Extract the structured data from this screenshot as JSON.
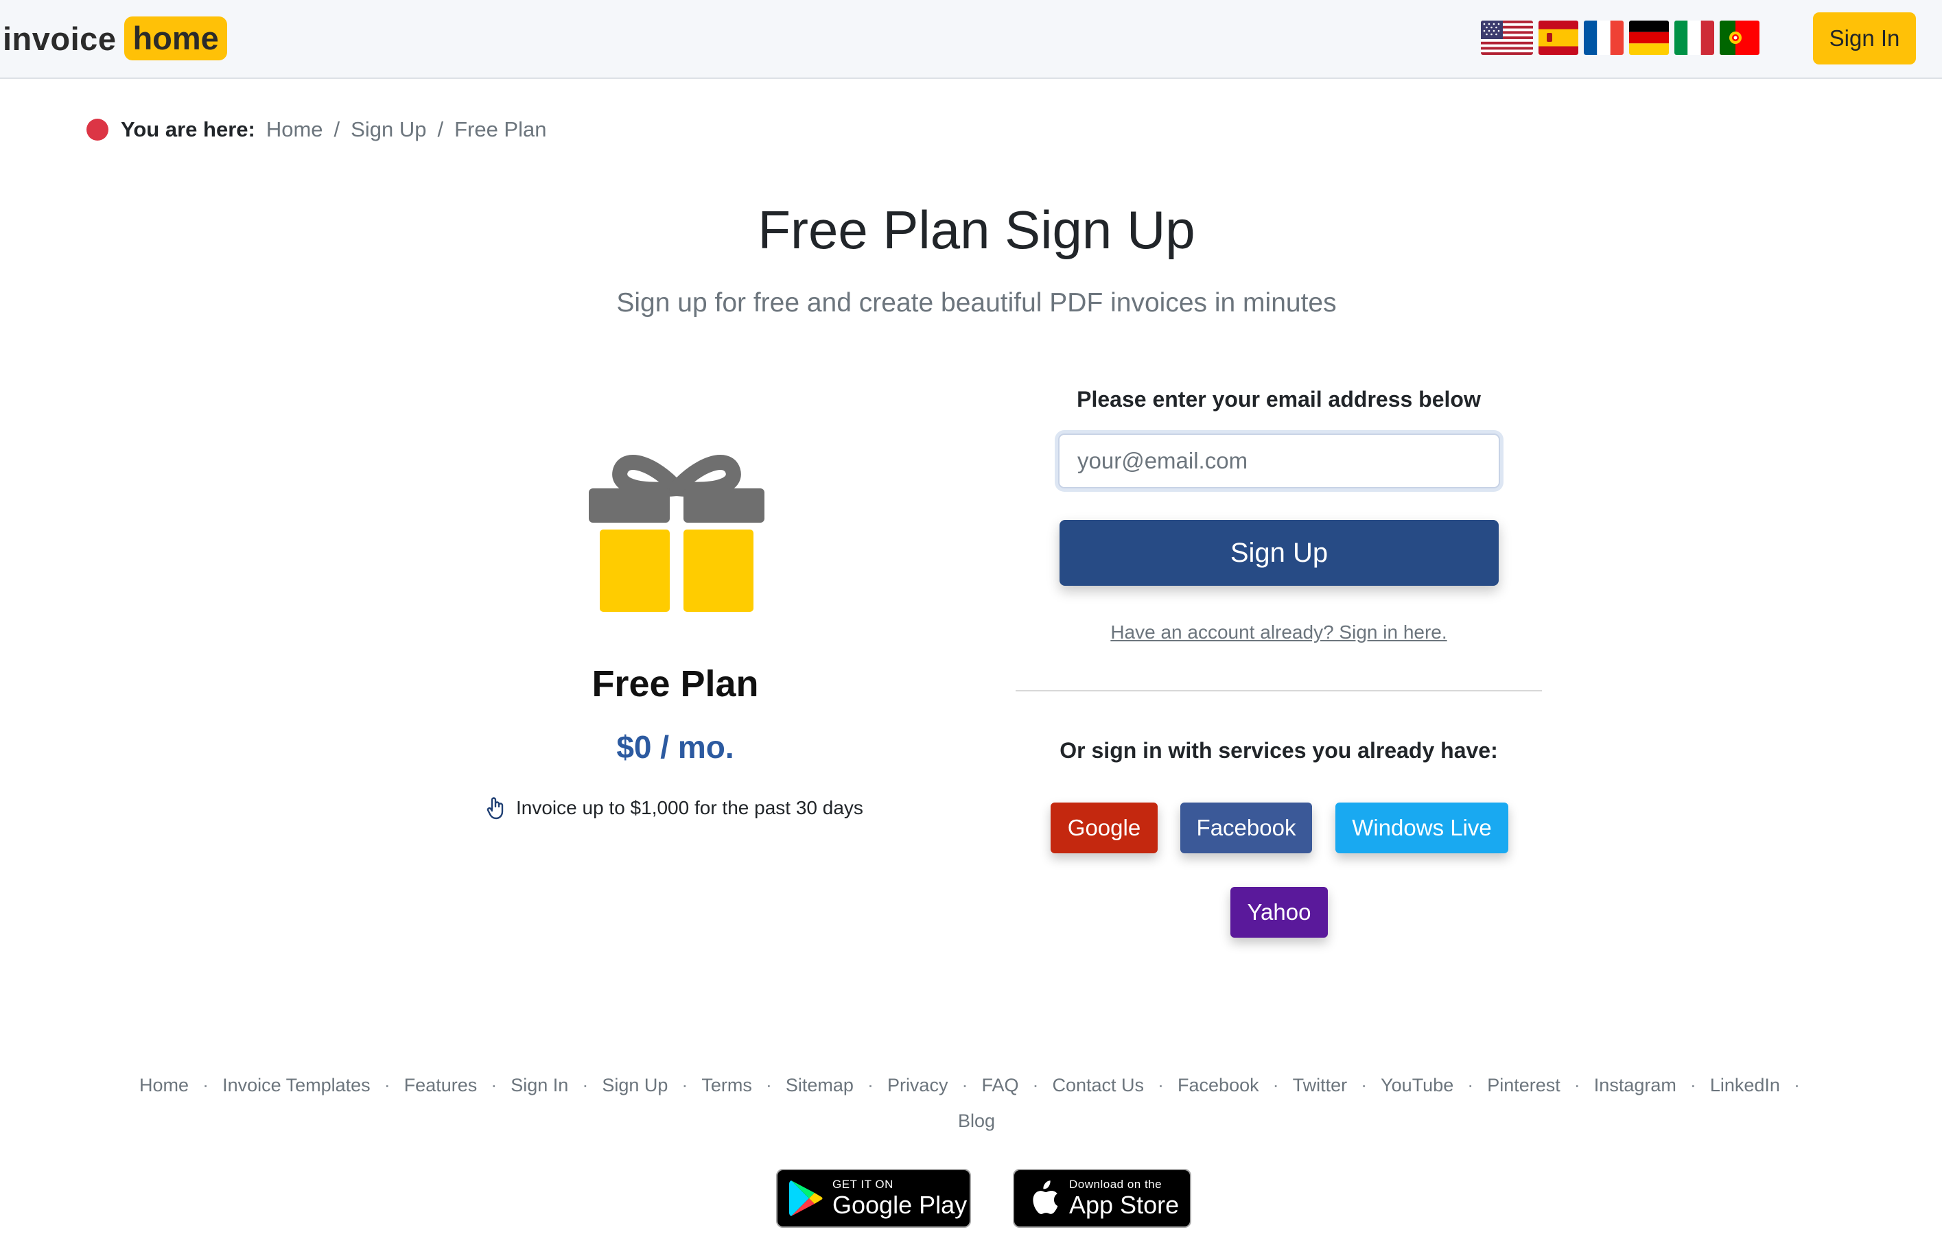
{
  "header": {
    "logo_part1": "invoice",
    "logo_part2": "home",
    "signin_label": "Sign In",
    "flags": [
      "us-flag",
      "spain-flag",
      "france-flag",
      "germany-flag",
      "italy-flag",
      "portugal-flag"
    ]
  },
  "breadcrumb": {
    "here_label": "You are here:",
    "items": [
      "Home",
      "Sign Up"
    ],
    "current": "Free Plan"
  },
  "page": {
    "title": "Free Plan Sign Up",
    "subtitle": "Sign up for free and create beautiful PDF invoices in minutes"
  },
  "plan": {
    "icon": "gift-icon",
    "name": "Free Plan",
    "price": "$0 / mo.",
    "feature_icon": "hand-pointer-icon",
    "feature": "Invoice up to $1,000 for the past 30 days"
  },
  "form": {
    "label": "Please enter your email address below",
    "email_placeholder": "your@email.com",
    "email_value": "",
    "signup_label": "Sign Up",
    "have_account": "Have an account already? Sign in here."
  },
  "social": {
    "label": "Or sign in with services you already have:",
    "google": "Google",
    "facebook": "Facebook",
    "windows": "Windows Live",
    "yahoo": "Yahoo"
  },
  "footer": {
    "links": [
      "Home",
      "Invoice Templates",
      "Features",
      "Sign In",
      "Sign Up",
      "Terms",
      "Sitemap",
      "Privacy",
      "FAQ",
      "Contact Us",
      "Facebook",
      "Twitter",
      "YouTube",
      "Pinterest",
      "Instagram",
      "LinkedIn",
      "Blog"
    ],
    "google_play_small": "GET IT ON",
    "google_play_big": "Google Play",
    "app_store_small": "Download on the",
    "app_store_big": "App Store"
  },
  "colors": {
    "accent_yellow": "#ffc107",
    "signup_blue": "#274b85",
    "price_blue": "#2c5aa0",
    "google_red": "#c4280f",
    "facebook_blue": "#3b5998",
    "windows_live_blue": "#19a9f1",
    "yahoo_purple": "#5a199b",
    "breadcrumb_dot": "#dc3545"
  }
}
